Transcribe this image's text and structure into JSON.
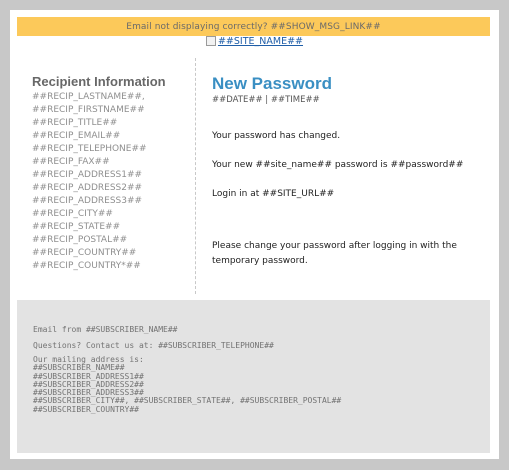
{
  "banner": {
    "text": "Email not displaying correctly? ##SHOW_MSG_LINK##"
  },
  "logo": {
    "alt_text": "##SITE_NAME##"
  },
  "recipient": {
    "heading": "Recipient Information",
    "fields": [
      "##RECIP_LASTNAME##,",
      "##RECIP_FIRSTNAME##",
      "##RECIP_TITLE##",
      "##RECIP_EMAIL##",
      "##RECIP_TELEPHONE##",
      "##RECIP_FAX##",
      "##RECIP_ADDRESS1##",
      "##RECIP_ADDRESS2##",
      "##RECIP_ADDRESS3##",
      "##RECIP_CITY##",
      "##RECIP_STATE##",
      "##RECIP_POSTAL##",
      "##RECIP_COUNTRY##",
      "##RECIP_COUNTRY*##"
    ]
  },
  "message": {
    "title": "New Password",
    "datetime": "##DATE## | ##TIME##",
    "changed": "Your password has changed.",
    "new_password": "Your new ##site_name## password is ##password##",
    "login": "Login in at ##SITE_URL##",
    "note": "Please change your password after logging in with the temporary password."
  },
  "footer": {
    "email_from": "Email from ##SUBSCRIBER_NAME##",
    "questions": "Questions? Contact us at: ##SUBSCRIBER_TELEPHONE##",
    "address_label": "Our mailing address is:",
    "address_lines": [
      "##SUBSCRIBER_NAME##",
      "##SUBSCRIBER_ADDRESS1##",
      "##SUBSCRIBER_ADDRESS2##",
      "##SUBSCRIBER_ADDRESS3##",
      "##SUBSCRIBER_CITY##, ##SUBSCRIBER_STATE##, ##SUBSCRIBER_POSTAL##",
      "##SUBSCRIBER_COUNTRY##"
    ]
  },
  "colors": {
    "banner_bg": "#fcc95a",
    "title": "#3a8fc3",
    "footer_bg": "#e3e3e3",
    "page_bg": "#c8c8c8"
  }
}
